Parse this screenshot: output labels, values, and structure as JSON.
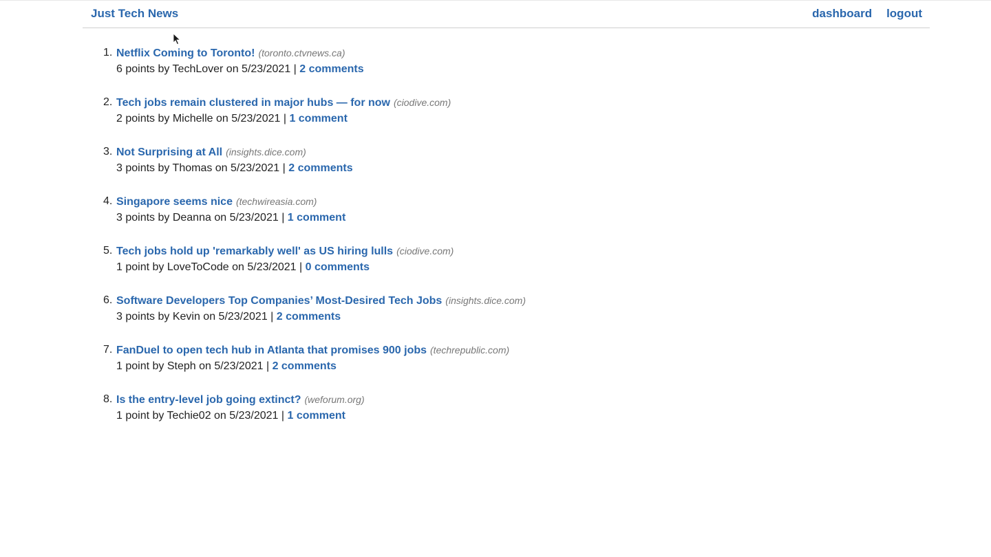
{
  "header": {
    "site_title": "Just Tech News",
    "nav": {
      "dashboard": "dashboard",
      "logout": "logout"
    }
  },
  "posts": [
    {
      "num": "1.",
      "title": "Netflix Coming to Toronto!",
      "source": "(toronto.ctvnews.ca)",
      "meta": "6 points by TechLover on 5/23/2021 | ",
      "comments": "2 comments"
    },
    {
      "num": "2.",
      "title": "Tech jobs remain clustered in major hubs — for now",
      "source": "(ciodive.com)",
      "meta": "2 points by Michelle on 5/23/2021 | ",
      "comments": "1 comment"
    },
    {
      "num": "3.",
      "title": "Not Surprising at All",
      "source": "(insights.dice.com)",
      "meta": "3 points by Thomas on 5/23/2021 | ",
      "comments": "2 comments"
    },
    {
      "num": "4.",
      "title": "Singapore seems nice",
      "source": "(techwireasia.com)",
      "meta": "3 points by Deanna on 5/23/2021 | ",
      "comments": "1 comment"
    },
    {
      "num": "5.",
      "title": "Tech jobs hold up 'remarkably well' as US hiring lulls",
      "source": "(ciodive.com)",
      "meta": "1 point by LoveToCode on 5/23/2021 | ",
      "comments": "0 comments"
    },
    {
      "num": "6.",
      "title": "Software Developers Top Companies’ Most-Desired Tech Jobs",
      "source": "(insights.dice.com)",
      "meta": "3 points by Kevin on 5/23/2021 | ",
      "comments": "2 comments"
    },
    {
      "num": "7.",
      "title": "FanDuel to open tech hub in Atlanta that promises 900 jobs",
      "source": "(techrepublic.com)",
      "meta": "1 point by Steph on 5/23/2021 | ",
      "comments": "2 comments"
    },
    {
      "num": "8.",
      "title": "Is the entry-level job going extinct?",
      "source": "(weforum.org)",
      "meta": "1 point by Techie02 on 5/23/2021 | ",
      "comments": "1 comment"
    }
  ],
  "colors": {
    "link": "#2a67ad",
    "text": "#222222",
    "source": "#777777",
    "divider": "#cfcfcf"
  },
  "icons": {
    "cursor": "mouse-pointer-icon"
  }
}
